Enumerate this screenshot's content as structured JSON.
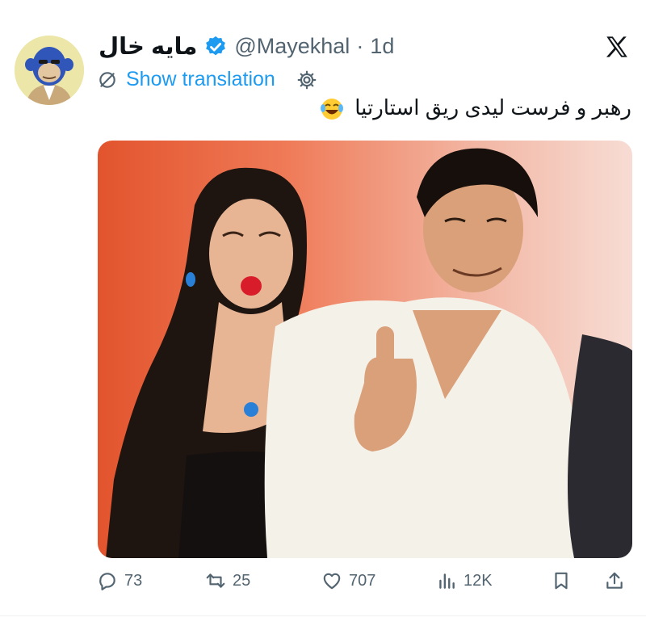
{
  "tweet": {
    "author_name": "مایه خال",
    "handle": "@Mayekhal",
    "separator": "·",
    "time": "1d",
    "translation_label": "Show translation",
    "text": "رهبر و فرست لیدی ریق استارتیا",
    "emoji": "face-with-tears-of-joy"
  },
  "metrics": {
    "replies": "73",
    "reposts": "25",
    "likes": "707",
    "views": "12K"
  },
  "icons": {
    "verified": "verified-badge-icon",
    "close": "x-logo-icon",
    "translate": "translate-icon",
    "settings": "gear-icon",
    "reply": "reply-icon",
    "repost": "repost-icon",
    "like": "heart-icon",
    "views": "views-icon",
    "bookmark": "bookmark-icon",
    "share": "share-icon"
  },
  "colors": {
    "link": "#1d9bf0",
    "muted": "#536471",
    "text": "#0f1419",
    "media_background": "#e2542d"
  }
}
